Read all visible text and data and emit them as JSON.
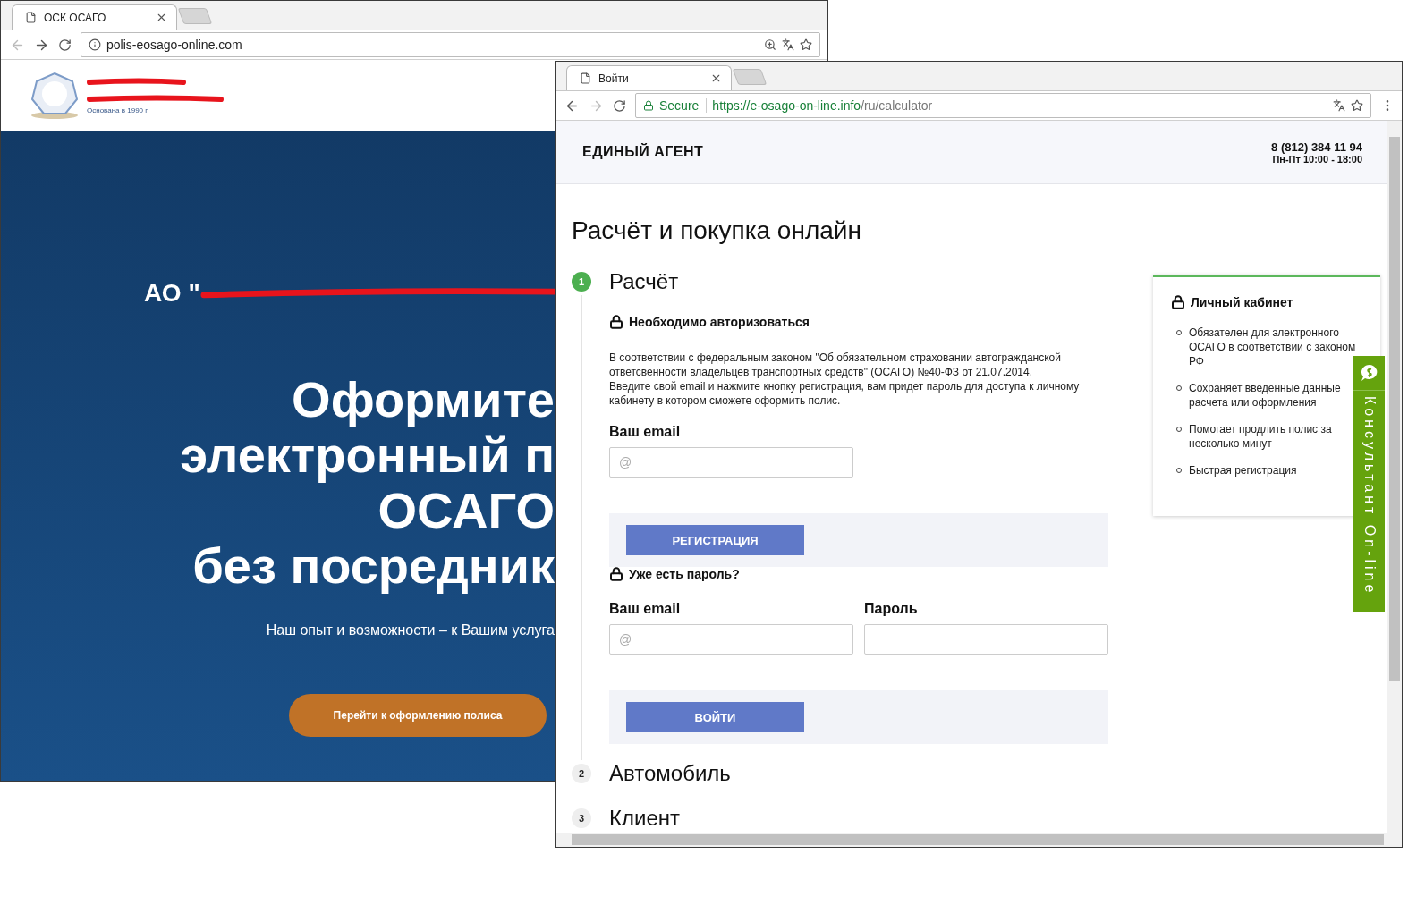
{
  "left_window": {
    "tab": {
      "title": "ОСК ОСАГО",
      "selected": true
    },
    "address": "polis-eosago-online.com",
    "logo": {
      "caption": "Основана в 1990 г."
    },
    "hero": {
      "org_prefix": "АО \"",
      "headline_lines": [
        "Оформите",
        "электронный п",
        "ОСАГО",
        "без посредник"
      ],
      "subtitle": "Наш опыт и возможности – к Вашим услуга",
      "cta": "Перейти к оформлению полиса"
    }
  },
  "right_window": {
    "tab": {
      "title": "Войти",
      "selected": true
    },
    "secure_label": "Secure",
    "address": {
      "origin": "https://e-osago-on-line.info",
      "path": "/ru/calculator"
    },
    "header": {
      "brand": "ЕДИНЫЙ АГЕНТ",
      "phone": "8 (812) 384 11 94",
      "hours": "Пн-Пт 10:00 - 18:00"
    },
    "page_title": "Расчёт и покупка онлайн",
    "steps": [
      {
        "number": "1",
        "title": "Расчёт",
        "active": true
      },
      {
        "number": "2",
        "title": "Автомобиль",
        "active": false
      },
      {
        "number": "3",
        "title": "Клиент",
        "active": false
      }
    ],
    "auth": {
      "heading": "Необходимо авторизоваться",
      "paragraph_lines": [
        "В соответствии с федеральным законом \"Об обязательном страховании автогражданской ответсвенности владельцев транспортных средств\" (ОСАГО) №40-ФЗ от 21.07.2014.",
        "Введите свой email и нажмите кнопку регистрация, вам придет пароль для доступа к личному кабинету в котором сможете оформить полис."
      ],
      "email_label": "Ваш email",
      "email_placeholder": "@",
      "register_button": "РЕГИСТРАЦИЯ",
      "login_heading": "Уже есть пароль?",
      "login_email_label": "Ваш email",
      "login_email_placeholder": "@",
      "password_label": "Пароль",
      "login_button": "ВОЙТИ"
    },
    "cabinet": {
      "title": "Личный кабинет",
      "items": [
        "Обязателен для электронного ОСАГО в соответствии с законом РФ",
        "Сохраняет введенные данные расчета или оформления",
        "Помогает продлить полис за несколько минут",
        "Быстрая регистрация"
      ]
    },
    "consultant": "Консультант On-line"
  }
}
